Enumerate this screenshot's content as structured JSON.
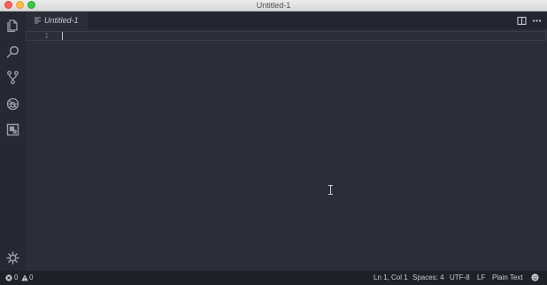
{
  "window": {
    "title": "Untitled-1"
  },
  "activity_bar": {
    "items": [
      {
        "icon": "explorer-icon"
      },
      {
        "icon": "search-icon"
      },
      {
        "icon": "source-control-icon"
      },
      {
        "icon": "debug-icon"
      },
      {
        "icon": "extensions-icon"
      }
    ],
    "bottom_icon": "gear-icon"
  },
  "tabs": [
    {
      "label": "Untitled-1",
      "icon": "plain-text-file-icon",
      "active": true,
      "italic": true
    }
  ],
  "tab_actions": [
    {
      "icon": "split-editor-icon"
    },
    {
      "icon": "more-actions-icon"
    }
  ],
  "editor": {
    "line_numbers": [
      "1"
    ],
    "lines": [
      ""
    ]
  },
  "status_bar": {
    "errors": "0",
    "warnings": "0",
    "position": "Ln 1, Col 1",
    "indentation": "Spaces: 4",
    "encoding": "UTF-8",
    "eol": "LF",
    "language": "Plain Text",
    "feedback_icon": "smiley-icon"
  },
  "colors": {
    "editor_bg": "#2b2e39",
    "activity_bar_bg": "#262833",
    "tab_bar_bg": "#232530",
    "status_bar_bg": "#1f212a",
    "text": "#c9cbd3"
  }
}
